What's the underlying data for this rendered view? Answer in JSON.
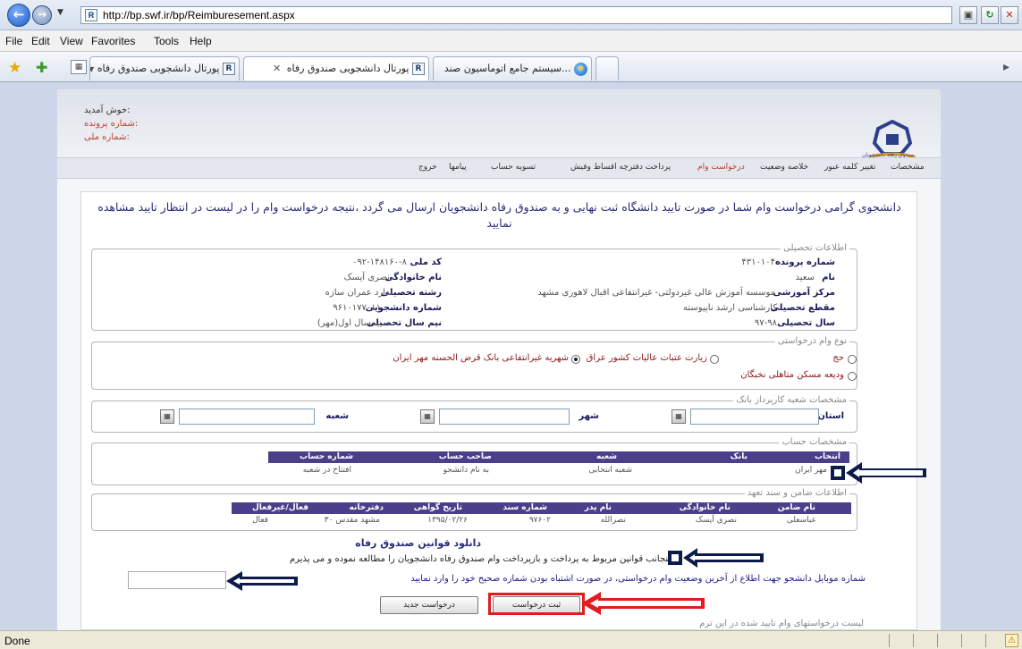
{
  "browser": {
    "url": "http://bp.swf.ir/bp/Reimburesement.aspx",
    "menu": [
      "File",
      "Edit",
      "View",
      "Favorites",
      "Tools",
      "Help"
    ],
    "tabs": [
      {
        "title": "پورتال دانشجویی صندوق رفاه"
      },
      {
        "title": "پورتال دانشجویی صندوق رفاه"
      },
      {
        "title": "...سیستم جامع اتوماسیون صند"
      }
    ],
    "status": "Done"
  },
  "header": {
    "welcome": "خوش آمدید:",
    "file_number_label": "شماره پرونده:",
    "national_id_label": "شماره ملی:",
    "logo_caption": "صندوق رفاه دانشجویان"
  },
  "nav": {
    "items": [
      "مشخصات",
      "تغییر کلمه عبور",
      "خلاصه وضعیت",
      "درخواست وام",
      "پرداخت دفترچه اقساط وفیش",
      "تسویه حساب",
      "پیامها",
      "خروج"
    ]
  },
  "notice": "دانشجوی گرامی درخواست وام شما در صورت تایید دانشگاه ثبت نهایی و به صندوق رفاه دانشجویان ارسال می گردد ،نتیجه درخواست وام را در لیست در انتظار تایید مشاهده نمایید",
  "education": {
    "legend": "اطلاعات تحصیلی",
    "right": [
      {
        "label": "شماره پرونده",
        "value": "۴۳۱۰۱۰۴"
      },
      {
        "label": "نام",
        "value": "سعید"
      },
      {
        "label": "مرکز آموزشی",
        "value": "موسسه آموزش عالی غیردولتی- غیرانتفاعی اقبال لاهوری مشهد"
      },
      {
        "label": "مقطع تحصیلی",
        "value": "کارشناسی ارشد ناپیوسته"
      },
      {
        "label": "سال تحصیلی",
        "value": "۹۷-۹۸"
      }
    ],
    "left": [
      {
        "label": "کد ملی",
        "value": "۰۹۲-۱۴۸۱۶۰-۸"
      },
      {
        "label": "نام خانوادگی",
        "value": "نصری آیسک"
      },
      {
        "label": "رشته تحصیلی",
        "value": "ندارد   عمران سازه"
      },
      {
        "label": "شماره دانشجویی",
        "value": "۹۶۱۰۱۷۷۰۱۱"
      },
      {
        "label": "نیم سال تحصیلی",
        "value": "نیمسال اول(مهر)"
      }
    ]
  },
  "loan_type": {
    "legend": "نوع وام درخواستی",
    "options": [
      {
        "label": "حج",
        "checked": false
      },
      {
        "label": "زیارت عتبات عالیات کشور عراق",
        "checked": false
      },
      {
        "label": "شهریه غیرانتفاعی بانک قرض الحسنه مهر ایران",
        "checked": true
      },
      {
        "label": "ودیعه مسکن متاهلی نخبگان",
        "checked": false
      }
    ]
  },
  "branch": {
    "legend": "مشخصات شعبه کارپرداز بانک",
    "province_label": "استان",
    "city_label": "شهر",
    "branch_label": "شعبه"
  },
  "account": {
    "legend": "مشخصات حساب",
    "headers": [
      "انتخاب",
      "بانک",
      "شعبه",
      "صاحب حساب",
      "شماره حساب"
    ],
    "row": [
      "",
      "مهر ایران",
      "شعبه انتخابی",
      "به نام دانشجو",
      "افتتاح در شعبه"
    ]
  },
  "guarantor": {
    "legend": "اطلاعات ضامن و سند تعهد",
    "headers": [
      "نام ضامن",
      "نام خانوادگی",
      "نام پدر",
      "شماره سند",
      "تاریخ گواهی",
      "دفترخانه",
      "فعال/غیرفعال"
    ],
    "row": [
      "عباسعلی",
      "نصری آیسک",
      "نصرالله",
      "۹۷۶۰۲",
      "۱۳۹۵/۰۲/۲۶",
      "مشهد مقدس ۳۰",
      "فعال"
    ]
  },
  "download_title": "دانلود قوانین صندوق رفاه",
  "agreement_text": "اینجانب قوانین مربوط به پرداخت و بازپرداخت وام صندوق رفاه دانشجویان را مطالعه نموده و می پذیرم",
  "mobile_text": "شماره موبایل دانشجو جهت اطلاع از آخرین وضعیت وام درخواستی، در صورت اشتباه بودن شماره صحیح خود را وارد نمایید",
  "buttons": {
    "submit": "ثبت درخواست",
    "new": "درخواست جدید"
  },
  "history_text": "لیست درخواستهای وام تایید شده در این ترم",
  "icons": [
    "back-icon",
    "forward-icon",
    "page-icon",
    "compat-icon",
    "refresh-icon",
    "stop-icon",
    "favorites-star-icon",
    "add-favorites-icon",
    "quick-tabs-icon",
    "ie-icon",
    "calendar-icon",
    "arrow-icon",
    "lock-icon"
  ],
  "colors": {
    "nav_active": "#c0392b",
    "grid_header": "#4b3f8a",
    "highlight": "#e01c1c",
    "arrow": "#0d1b4a"
  }
}
